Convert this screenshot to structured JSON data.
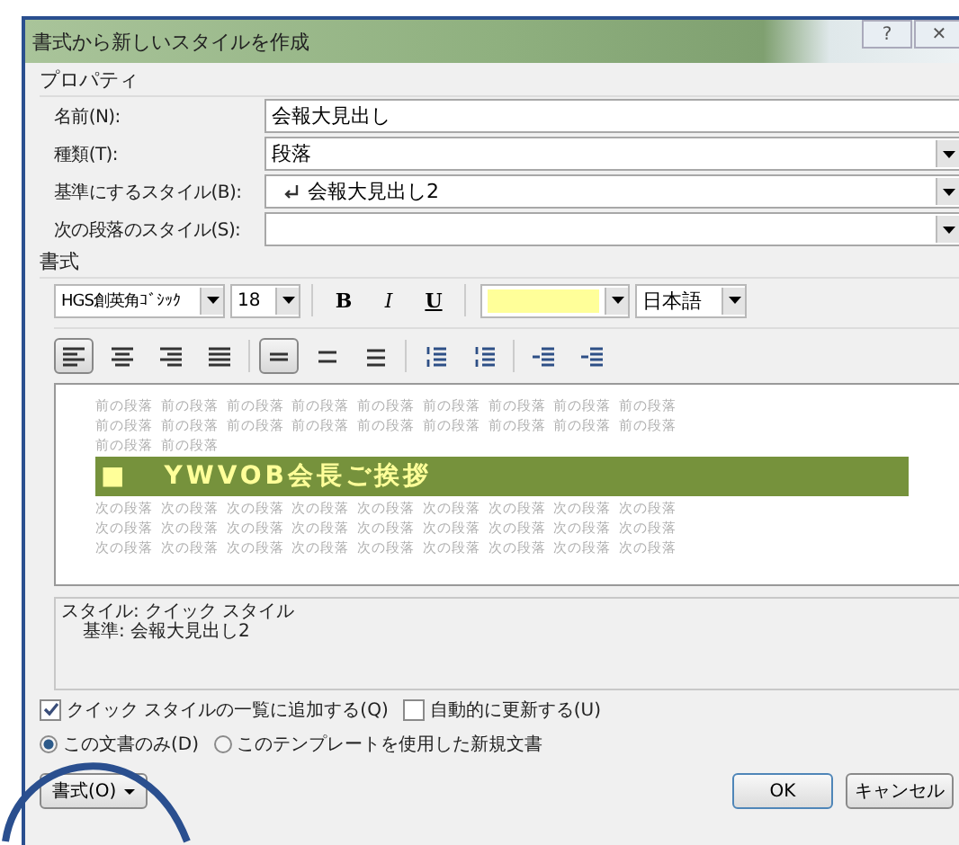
{
  "window": {
    "title": "書式から新しいスタイルを作成",
    "help": "?",
    "close": "✕"
  },
  "properties": {
    "heading": "プロパティ",
    "fields": [
      {
        "label": "名前(N):",
        "value": "会報大見出し",
        "kind": "text"
      },
      {
        "label": "種類(T):",
        "value": "段落",
        "kind": "dropdown"
      },
      {
        "label": "基準にするスタイル(B):",
        "value": "会報大見出し2",
        "kind": "style-dropdown"
      },
      {
        "label": "次の段落のスタイル(S):",
        "kind": "dropdown"
      }
    ]
  },
  "format": {
    "heading": "書式",
    "font": "HGS創英角ｺﾞｼｯｸ",
    "size": "18",
    "styles": [
      {
        "label": "B",
        "kind": "bold"
      },
      {
        "label": "I",
        "kind": "italic"
      },
      {
        "label": "U",
        "kind": "underline"
      }
    ],
    "language": "日本語",
    "paragraph_buttons": [
      {
        "kind": "align-left",
        "selected": true
      },
      {
        "kind": "align-center",
        "selected": false
      },
      {
        "kind": "align-right",
        "selected": false
      },
      {
        "kind": "justify",
        "selected": false
      },
      {
        "kind": "sep"
      },
      {
        "kind": "single-spacing",
        "selected": true
      },
      {
        "kind": "one-half-spacing",
        "selected": false
      },
      {
        "kind": "double-spacing",
        "selected": false
      },
      {
        "kind": "sep"
      },
      {
        "kind": "space-increase",
        "selected": false
      },
      {
        "kind": "space-decrease",
        "selected": false
      },
      {
        "kind": "sep"
      },
      {
        "kind": "indent-decrease",
        "selected": false
      },
      {
        "kind": "indent-increase",
        "selected": false
      }
    ]
  },
  "preview": {
    "before_lines": [
      "前の段落 前の段落 前の段落 前の段落 前の段落 前の段落 前の段落 前の段落 前の段落",
      "前の段落 前の段落 前の段落 前の段落 前の段落 前の段落 前の段落 前の段落 前の段落",
      "前の段落 前の段落"
    ],
    "heading_mark": "■",
    "heading": "YWVOB会長ご挨拶",
    "after_lines": [
      "次の段落 次の段落 次の段落 次の段落 次の段落 次の段落 次の段落 次の段落 次の段落",
      "次の段落 次の段落 次の段落 次の段落 次の段落 次の段落 次の段落 次の段落 次の段落",
      "次の段落 次の段落 次の段落 次の段落 次の段落 次の段落 次の段落 次の段落 次の段落"
    ]
  },
  "description": [
    "スタイル: クイック スタイル",
    "基準: 会報大見出し2"
  ],
  "checkboxes": [
    {
      "label": "クイック スタイルの一覧に追加する(Q)",
      "checked": true
    },
    {
      "label": "自動的に更新する(U)",
      "checked": false
    }
  ],
  "radios": [
    {
      "label": "この文書のみ(D)",
      "selected": true
    },
    {
      "label": "このテンプレートを使用した新規文書",
      "selected": false
    }
  ],
  "format_button": "書式(O)",
  "buttons": [
    "OK",
    "キャンセル"
  ]
}
